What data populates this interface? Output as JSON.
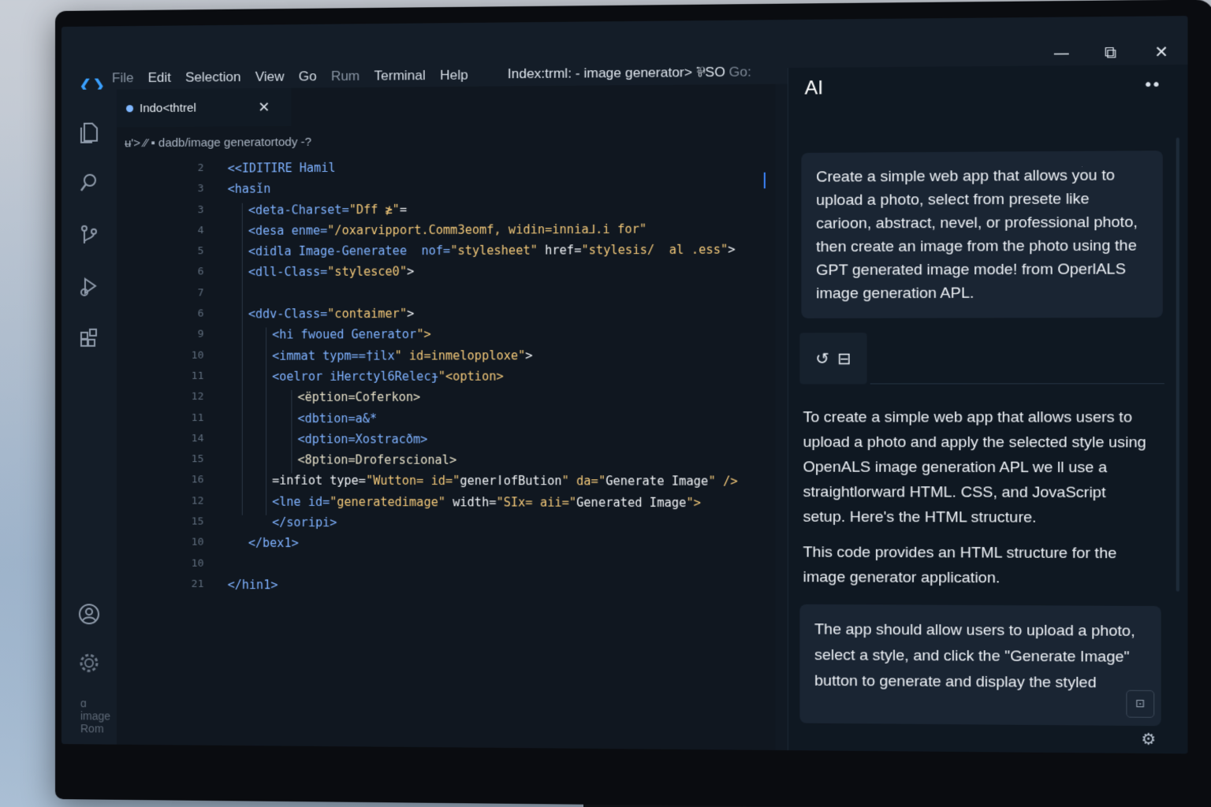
{
  "menu": {
    "logo": "❮❯",
    "items": [
      {
        "label": "File",
        "dim": true
      },
      {
        "label": "Edit",
        "dim": false
      },
      {
        "label": "Selection",
        "dim": false
      },
      {
        "label": "View",
        "dim": false
      },
      {
        "label": "Go",
        "dim": false
      },
      {
        "label": "Rum",
        "dim": true
      },
      {
        "label": "Terminal",
        "dim": false
      },
      {
        "label": "Help",
        "dim": false
      }
    ]
  },
  "window": {
    "title": "Index:trml: - image generator> ⅌SO",
    "title_dim": "Go:",
    "minimize": "—",
    "restore": "⧉",
    "close": "✕"
  },
  "activity": {
    "icons": [
      "files-icon",
      "search-icon",
      "source-control-icon",
      "run-debug-icon",
      "extensions-icon",
      "account-icon",
      "settings-icon"
    ],
    "status_text": "ɑ image Rom"
  },
  "editor": {
    "tab_label": "Indo<thtrel",
    "tab_close": "✕",
    "breadcrumb": "ʉ'> ⁄⁄ ▪ dadb/image generatortody -?",
    "lines": [
      {
        "n": "2",
        "indent": 0,
        "html": "<<IDITIRE Hamil"
      },
      {
        "n": "3",
        "indent": 0,
        "html": "<hasǐn"
      },
      {
        "n": "3",
        "indent": 1,
        "html": "<deta-Charset=\"Dff ≱\"="
      },
      {
        "n": "4",
        "indent": 1,
        "html": "<desa enme=\"/oxarvipport.CommЗeomf, widin=innia⅃.i for\""
      },
      {
        "n": "5",
        "indent": 1,
        "html": "<didla Image-Generatee  nof=\"stylesheet\" href=\"stylesis/  al .ess\">"
      },
      {
        "n": "6",
        "indent": 1,
        "html": "<dll-Class=\"stylesce0\">"
      },
      {
        "n": "7",
        "indent": 0,
        "html": ""
      },
      {
        "n": "6",
        "indent": 1,
        "html": "<ddv-Class=\"contaimer\">"
      },
      {
        "n": "9",
        "indent": 2,
        "html": "<hi fwoued Generator\">"
      },
      {
        "n": "10",
        "indent": 2,
        "html": "<immat typm==†ilx\" id=inmelopploxe\">"
      },
      {
        "n": "11",
        "indent": 2,
        "html": "<oelror iHerctyl6Relecɟ\"<option>"
      },
      {
        "n": "12",
        "indent": 3,
        "html": "<ëption=Coferkon>"
      },
      {
        "n": "11",
        "indent": 3,
        "html": "<dbtion=a&*"
      },
      {
        "n": "14",
        "indent": 3,
        "html": "<dption=Xostracðm>"
      },
      {
        "n": "15",
        "indent": 3,
        "html": "<8ption=Droferscional>"
      },
      {
        "n": "16",
        "indent": 2,
        "html": "=infiot type=\"Wutton= id=\"generǀofBution\" da=\"Generate Image\" />"
      },
      {
        "n": "12",
        "indent": 2,
        "html": "<lne id=\"generatedimage\" width=\"SIx= aii=\"Generated Image\">"
      },
      {
        "n": "15",
        "indent": 2,
        "html": "</soripi>"
      },
      {
        "n": "10",
        "indent": 1,
        "html": "</bex1>"
      },
      {
        "n": "10",
        "indent": 0,
        "html": ""
      },
      {
        "n": "21",
        "indent": 0,
        "html": "</hin1>"
      }
    ]
  },
  "ai": {
    "title": "AI",
    "more": "••",
    "prompt": "Create a simple web app that allows you to upload a photo, select from presete like carioon, abstract, nevel, or professional photo, then create an image from the photo using the GPT generated image mode! from OperlALS image generation APL.",
    "toolbar_icons": [
      "↺",
      "⊟"
    ],
    "reply_1": "To create a simple web app that allows users to upload a photo and apply the selected style using OpenALS image generation APL we ll use a straightlorward HTML. CSS, and JovaScript setup. Here's the HTML structure.",
    "reply_2": "This code provides an HTML structure for the image generator application.",
    "reply_3": "The app should allow users to upload a photo, select a style, and click the \"Generate Image\" button to generate and display the styled",
    "footer_icon": "⊡",
    "corner_icon": "⚙"
  }
}
